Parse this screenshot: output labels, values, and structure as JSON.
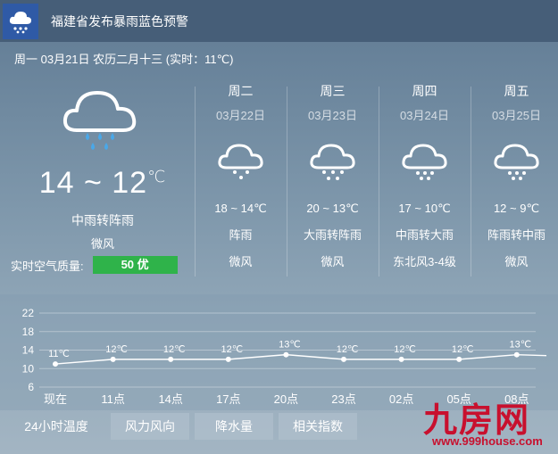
{
  "alert": {
    "icon": "rain-cloud-icon",
    "text": "福建省发布暴雨蓝色预警",
    "icon_bg": "#2f5aa6"
  },
  "header": {
    "date_line": "周一 03月21日 农历二月十三 (实时：11℃)"
  },
  "today": {
    "icon": "rain-cloud-icon",
    "temp": "14 ~ 12",
    "deg": "℃",
    "desc": "中雨转阵雨",
    "wind": "微风",
    "aqi_label": "实时空气质量:",
    "aqi_value": "50 优",
    "aqi_color": "#2fb34a"
  },
  "forecast": [
    {
      "day": "周二",
      "date": "03月22日",
      "icon": "light-rain-cloud-icon",
      "temp": "18 ~ 14℃",
      "desc": "阵雨",
      "wind": "微风"
    },
    {
      "day": "周三",
      "date": "03月23日",
      "icon": "heavy-rain-cloud-icon",
      "temp": "20 ~ 13℃",
      "desc": "大雨转阵雨",
      "wind": "微风"
    },
    {
      "day": "周四",
      "date": "03月24日",
      "icon": "rain-cloud-icon",
      "temp": "17 ~ 10℃",
      "desc": "中雨转大雨",
      "wind": "东北风3-4级"
    },
    {
      "day": "周五",
      "date": "03月25日",
      "icon": "rain-cloud-icon",
      "temp": "12 ~ 9℃",
      "desc": "阵雨转中雨",
      "wind": "微风"
    }
  ],
  "chart_data": {
    "type": "line",
    "categories": [
      "现在",
      "11点",
      "14点",
      "17点",
      "20点",
      "23点",
      "02点",
      "05点",
      "08点"
    ],
    "values": [
      11,
      12,
      12,
      12,
      13,
      12,
      12,
      12,
      13
    ],
    "value_labels": [
      "11℃",
      "12℃",
      "12℃",
      "12℃",
      "13℃",
      "12℃",
      "12℃",
      "12℃",
      "13℃"
    ],
    "yticks": [
      "22",
      "18",
      "14",
      "10",
      "6"
    ],
    "ylim": [
      6,
      22
    ],
    "grid": true
  },
  "tabs": [
    {
      "label": "24小时温度",
      "active": true
    },
    {
      "label": "风力风向",
      "active": false
    },
    {
      "label": "降水量",
      "active": false
    },
    {
      "label": "相关指数",
      "active": false
    }
  ],
  "watermark": {
    "title": "九房网",
    "url": "www.999house.com",
    "color": "#c8102e"
  }
}
